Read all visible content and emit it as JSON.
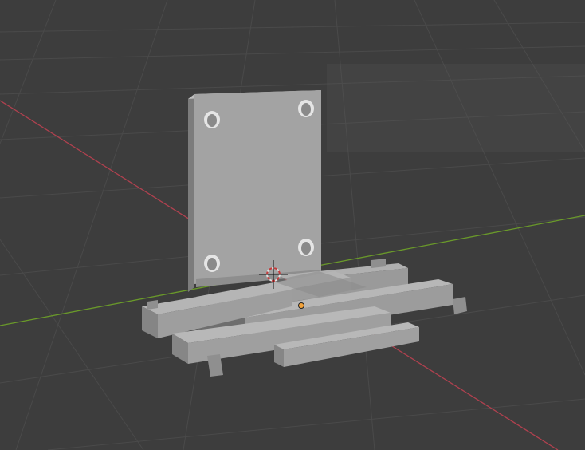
{
  "viewport": {
    "name": "3D Viewport",
    "background_color": "#3d3d3d",
    "grid_color": "#4a4a4a",
    "x_axis_color": "#b0414f",
    "y_axis_color": "#6a9a2a",
    "object_color": "#9e9e9e"
  },
  "scene": {
    "objects": [
      {
        "name": "mounting-plate",
        "holes": 4
      },
      {
        "name": "slatted-base",
        "slats": 5
      }
    ],
    "cursor": "3d-cursor-icon",
    "origin": "object-origin-icon"
  }
}
